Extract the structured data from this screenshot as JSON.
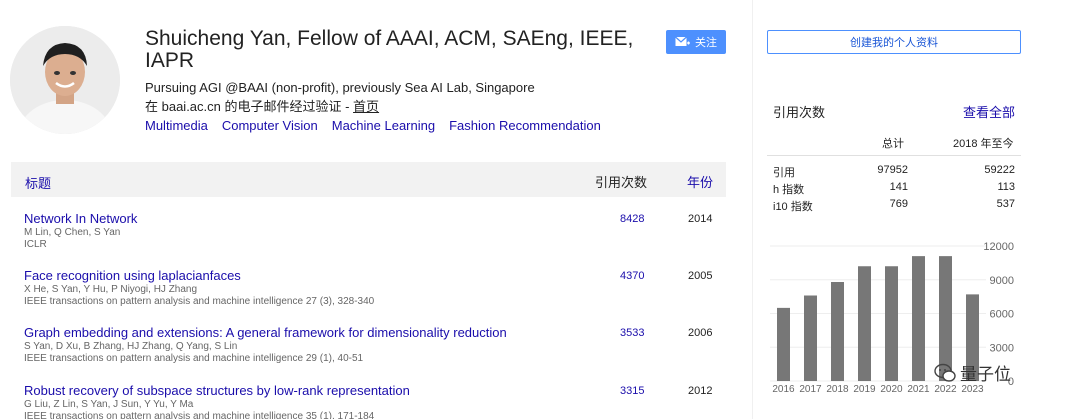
{
  "profile": {
    "name": "Shuicheng Yan, Fellow of AAAI, ACM, SAEng, IEEE, IAPR",
    "affiliation": "Pursuing AGI @BAAI (non-profit), previously Sea AI Lab, Singapore",
    "verify_prefix": "在 baai.ac.cn 的电子邮件经过验证 - ",
    "homepage_label": "首页",
    "interests": [
      "Multimedia",
      "Computer Vision",
      "Machine Learning",
      "Fashion Recommendation"
    ],
    "follow_label": "关注"
  },
  "table": {
    "col_title": "标题",
    "col_cites": "引用次数",
    "col_year": "年份",
    "papers": [
      {
        "title": "Network In Network",
        "authors": "M Lin, Q Chen, S Yan",
        "venue": "ICLR",
        "cites": "8428",
        "year": "2014"
      },
      {
        "title": "Face recognition using laplacianfaces",
        "authors": "X He, S Yan, Y Hu, P Niyogi, HJ Zhang",
        "venue": "IEEE transactions on pattern analysis and machine intelligence 27 (3), 328-340",
        "cites": "4370",
        "year": "2005"
      },
      {
        "title": "Graph embedding and extensions: A general framework for dimensionality reduction",
        "authors": "S Yan, D Xu, B Zhang, HJ Zhang, Q Yang, S Lin",
        "venue": "IEEE transactions on pattern analysis and machine intelligence 29 (1), 40-51",
        "cites": "3533",
        "year": "2006"
      },
      {
        "title": "Robust recovery of subspace structures by low-rank representation",
        "authors": "G Liu, Z Lin, S Yan, J Sun, Y Yu, Y Ma",
        "venue": "IEEE transactions on pattern analysis and machine intelligence 35 (1), 171-184",
        "cites": "3315",
        "year": "2012"
      }
    ]
  },
  "sidebar": {
    "create_profile_label": "创建我的个人资料",
    "cited_by_title": "引用次数",
    "view_all_label": "查看全部",
    "col_total": "总计",
    "col_since": "2018 年至今",
    "stats": [
      {
        "label": "引用",
        "total": "97952",
        "since": "59222"
      },
      {
        "label": "h 指数",
        "total": "141",
        "since": "113"
      },
      {
        "label": "i10 指数",
        "total": "769",
        "since": "537"
      }
    ],
    "watermark": "量子位"
  },
  "colors": {
    "link": "#1a0dab",
    "accent": "#4d90fe",
    "bar": "#777777"
  },
  "chart_data": {
    "type": "bar",
    "categories": [
      "2016",
      "2017",
      "2018",
      "2019",
      "2020",
      "2021",
      "2022",
      "2023"
    ],
    "values": [
      6500,
      7600,
      8800,
      10200,
      10200,
      11100,
      11100,
      7700
    ],
    "yticks": [
      0,
      3000,
      6000,
      9000,
      12000
    ],
    "ylim": [
      0,
      12000
    ],
    "yaxis_side": "right",
    "grid": true
  }
}
